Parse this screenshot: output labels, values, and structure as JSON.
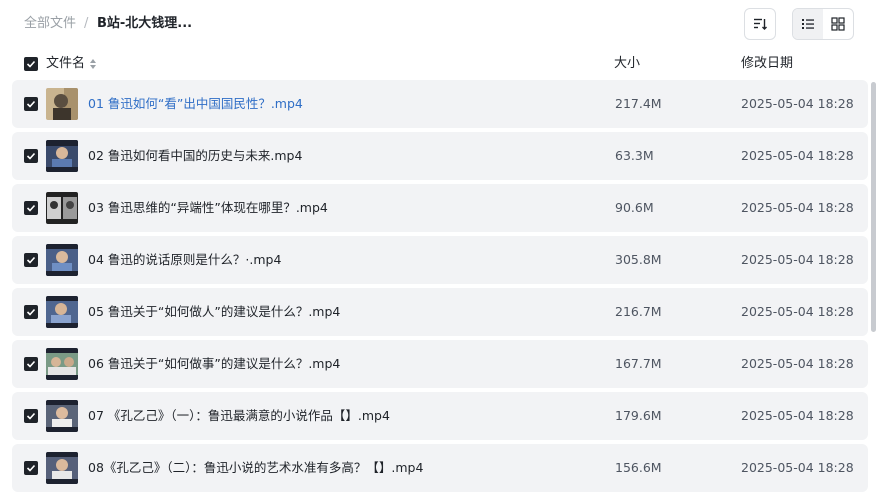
{
  "breadcrumb": {
    "root": "全部文件",
    "separator": "/",
    "current": "B站-北大钱理..."
  },
  "toolbar": {
    "sort_icon": "sort-descending-icon",
    "list_view_icon": "list-view-icon",
    "grid_view_icon": "grid-view-icon",
    "active_view": "list"
  },
  "columns": {
    "name": "文件名",
    "size": "大小",
    "modified": "修改日期"
  },
  "colors": {
    "link": "#2f6ec6",
    "row_bg": "#f2f3f5",
    "checkbox": "#1f2329"
  },
  "files": [
    {
      "name": "01 鲁迅如何“看”出中国国民性？.mp4",
      "size": "217.4M",
      "modified": "2025-05-04 18:28",
      "checked": true,
      "highlighted": true
    },
    {
      "name": "02 鲁迅如何看中国的历史与未来.mp4",
      "size": "63.3M",
      "modified": "2025-05-04 18:28",
      "checked": true,
      "highlighted": false
    },
    {
      "name": "03 鲁迅思维的“异端性”体现在哪里？.mp4",
      "size": "90.6M",
      "modified": "2025-05-04 18:28",
      "checked": true,
      "highlighted": false
    },
    {
      "name": "04 鲁迅的说话原则是什么？·.mp4",
      "size": "305.8M",
      "modified": "2025-05-04 18:28",
      "checked": true,
      "highlighted": false
    },
    {
      "name": "05 鲁迅关于“如何做人”的建议是什么？.mp4",
      "size": "216.7M",
      "modified": "2025-05-04 18:28",
      "checked": true,
      "highlighted": false
    },
    {
      "name": "06 鲁迅关于“如何做事”的建议是什么？.mp4",
      "size": "167.7M",
      "modified": "2025-05-04 18:28",
      "checked": true,
      "highlighted": false
    },
    {
      "name": "07 《孔乙己》（一）：鲁迅最满意的小说作品【】.mp4",
      "size": "179.6M",
      "modified": "2025-05-04 18:28",
      "checked": true,
      "highlighted": false
    },
    {
      "name": "08《孔乙己》（二）：鲁迅小说的艺术水准有多高？【】.mp4",
      "size": "156.6M",
      "modified": "2025-05-04 18:28",
      "checked": true,
      "highlighted": false
    }
  ]
}
